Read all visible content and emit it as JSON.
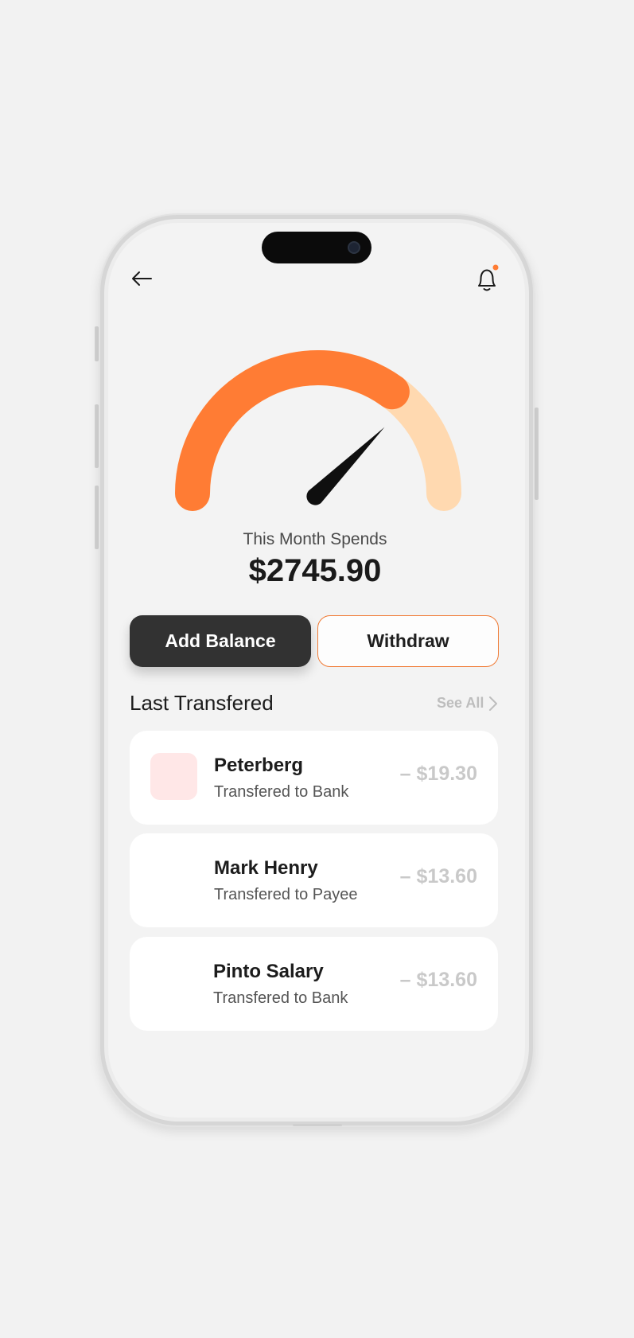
{
  "colors": {
    "accent": "#ff7c34",
    "accent_light": "#ffd9b0",
    "dark_button": "#323232",
    "muted_text": "#c9c9c9",
    "notification_dot": "#ff7c34",
    "thumb_pink": "#ffe7e7"
  },
  "header": {
    "back_icon": "arrow-left-icon",
    "notification_icon": "bell-icon"
  },
  "gauge": {
    "progress_fraction": 0.7,
    "needle_fraction": 0.75
  },
  "summary": {
    "label": "This Month Spends",
    "amount": "$2745.90"
  },
  "actions": {
    "add_balance_label": "Add Balance",
    "withdraw_label": "Withdraw"
  },
  "transfers": {
    "title": "Last Transfered",
    "see_all_label": "See All",
    "items": [
      {
        "name": "Peterberg",
        "subtitle": "Transfered to Bank",
        "amount": "– $19.30",
        "thumb_color": "#ffe7e7"
      },
      {
        "name": "Mark Henry",
        "subtitle": "Transfered to  Payee",
        "amount": "– $13.60",
        "thumb_color": ""
      },
      {
        "name": "Pinto Salary",
        "subtitle": "Transfered to Bank",
        "amount": "– $13.60",
        "thumb_color": ""
      }
    ]
  }
}
